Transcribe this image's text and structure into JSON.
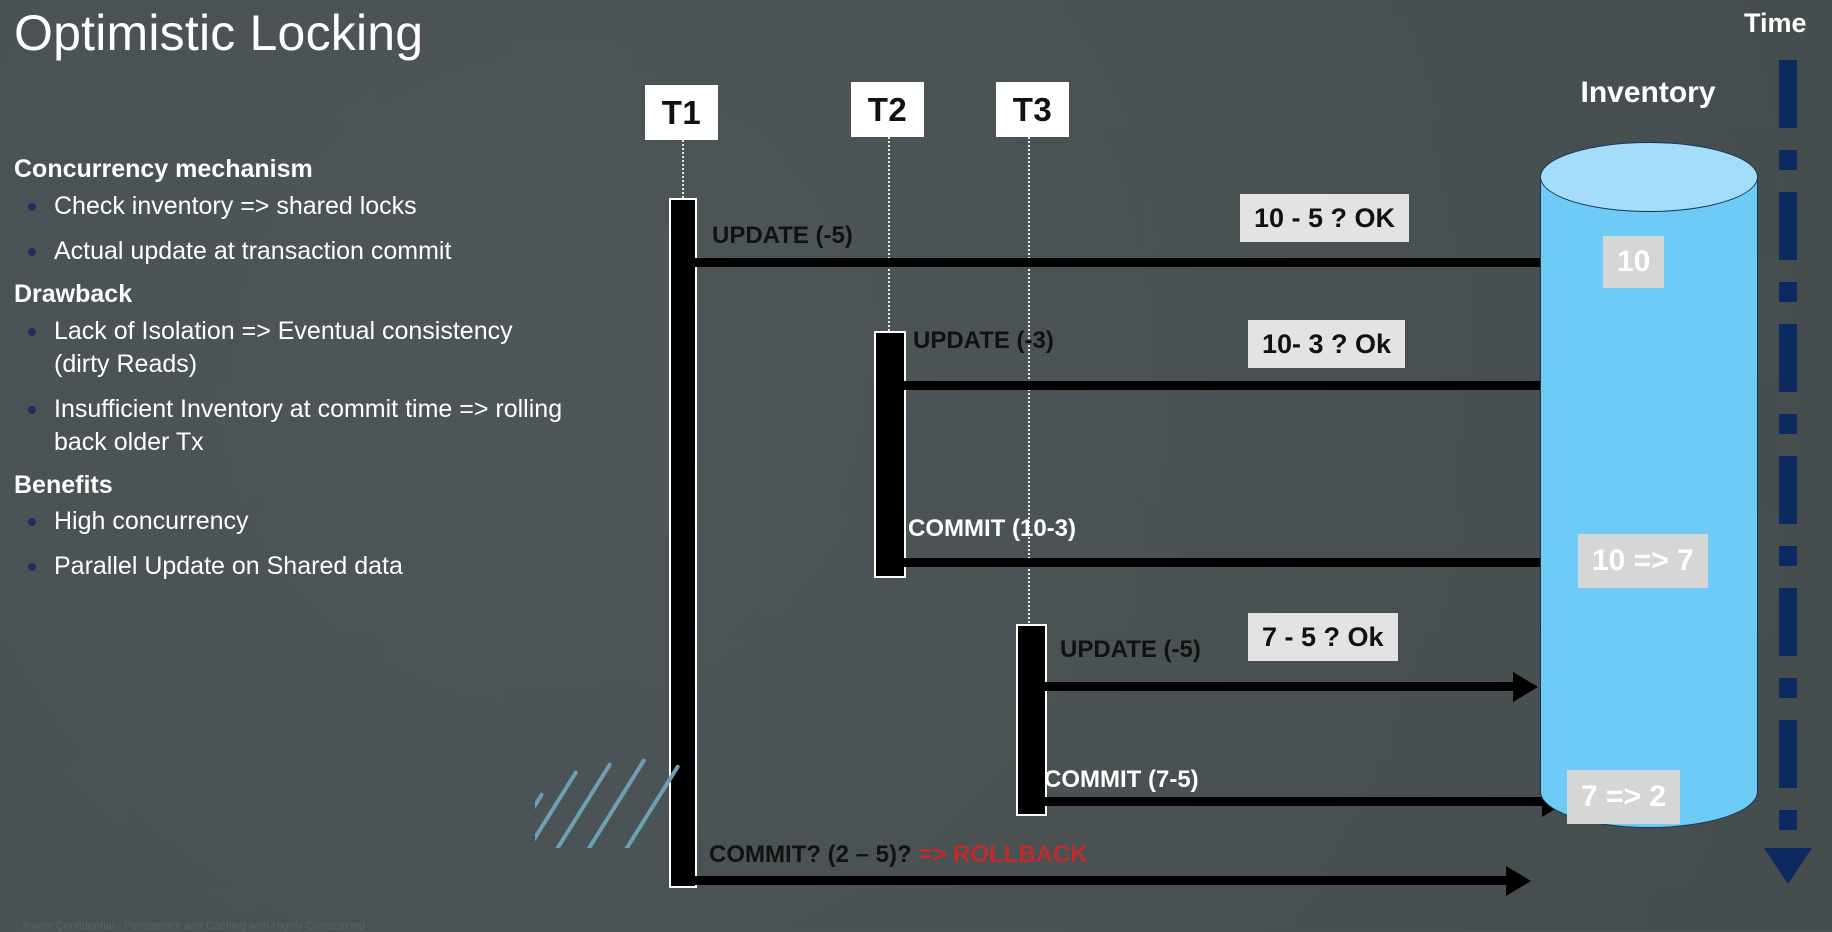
{
  "slide": {
    "title": "Optimistic Locking",
    "background_color": "#4a5254",
    "footer": "Xavier Confidential - Persistence and Caching with Highly Constrained"
  },
  "left_panel": {
    "sections": [
      {
        "heading": "Concurrency mechanism",
        "bullets": [
          "Check inventory  => shared locks",
          "Actual update at transaction commit"
        ]
      },
      {
        "heading": "Drawback",
        "bullets": [
          "Lack of Isolation => Eventual  consistency (dirty Reads)",
          "Insufficient Inventory at commit time => rolling back older Tx"
        ]
      },
      {
        "heading": "Benefits",
        "bullets": [
          "High concurrency",
          "Parallel Update on Shared data"
        ]
      }
    ]
  },
  "diagram": {
    "transactions": [
      {
        "label": "T1"
      },
      {
        "label": "T2"
      },
      {
        "label": "T3"
      }
    ],
    "messages": [
      {
        "label": "UPDATE (-5)",
        "from": "T1",
        "style": "dark"
      },
      {
        "label": "UPDATE (-3)",
        "from": "T2",
        "style": "dark"
      },
      {
        "label": "COMMIT (10-3)",
        "from": "T2",
        "style": "light"
      },
      {
        "label": "UPDATE (-5)",
        "from": "T3",
        "style": "dark"
      },
      {
        "label": "COMMIT (7-5)",
        "from": "T3",
        "style": "light"
      },
      {
        "label": "COMMIT?  (2 – 5)? ",
        "from": "T1",
        "style": "dark",
        "suffix": "=> ROLLBACK",
        "suffix_color": "#c02b2b"
      }
    ],
    "checks": [
      {
        "label": "10 - 5 ? OK"
      },
      {
        "label": "10- 3 ? Ok"
      },
      {
        "label": "7 - 5 ? Ok"
      }
    ],
    "inventory": {
      "title": "Inventory",
      "cylinder_color": "#6ecbf5",
      "cylinder_top_color": "#a4ddfa",
      "values": [
        {
          "label": "10"
        },
        {
          "label": "10 => 7"
        },
        {
          "label": "7 => 2"
        }
      ]
    },
    "time_axis": {
      "label": "Time",
      "color": "#0d2a60",
      "direction": "down"
    }
  }
}
